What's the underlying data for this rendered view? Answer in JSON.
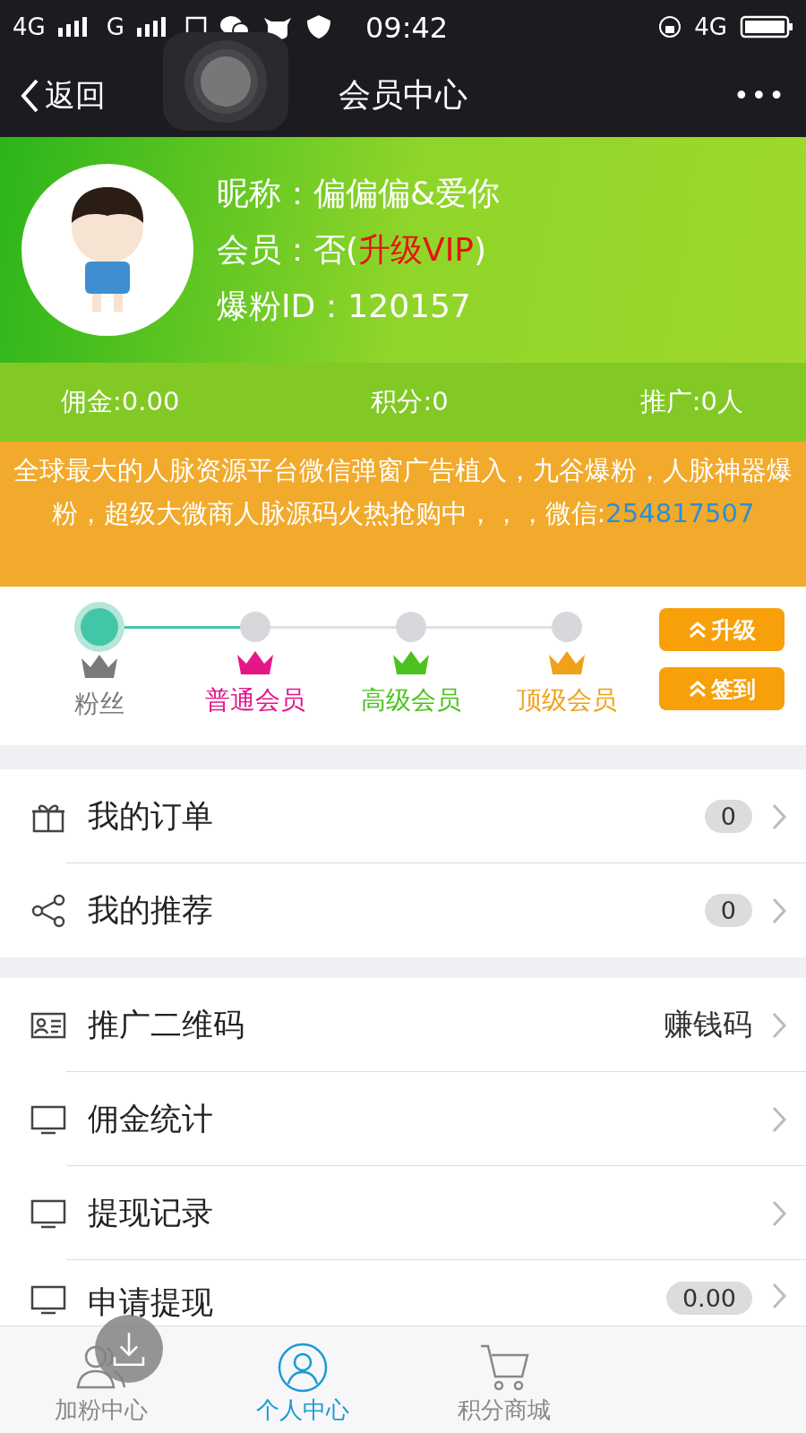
{
  "status_bar": {
    "network_1": "4G",
    "network_2": "G",
    "time": "09:42",
    "network_right": "4G"
  },
  "nav": {
    "back": "返回",
    "title": "会员中心",
    "more": "•••"
  },
  "profile": {
    "fields": [
      {
        "label": "昵称：",
        "value": "偏偏偏&爱你"
      },
      {
        "label": "会员：",
        "value": "否(",
        "link": "升级VIP",
        "suffix": ")"
      },
      {
        "label": "爆粉ID：",
        "value": "120157"
      }
    ]
  },
  "stats": [
    "佣金:0.00",
    "积分:0",
    "推广:0人"
  ],
  "notice": {
    "text": "全球最大的人脉资源平台微信弹窗广告植入，九谷爆粉，人脉神器爆粉，超级大微商人脉源码火热抢购中，，，微信:",
    "contact": "254817507"
  },
  "levels": [
    {
      "label": "粉丝",
      "color": "#7a7a7a",
      "selected": true
    },
    {
      "label": "普通会员",
      "color": "#e5168a",
      "selected": false
    },
    {
      "label": "高级会员",
      "color": "#4cc21e",
      "selected": false
    },
    {
      "label": "顶级会员",
      "color": "#f0a11a",
      "selected": false
    }
  ],
  "level_buttons": [
    "升级",
    "签到"
  ],
  "menu_groups": [
    [
      {
        "kind": "badge",
        "label": "我的订单",
        "badge": "0"
      },
      {
        "kind": "badge",
        "label": "我的推荐",
        "badge": "0"
      }
    ],
    [
      {
        "kind": "value",
        "label": "推广二维码",
        "value": "赚钱码"
      },
      {
        "kind": "plain",
        "label": "佣金统计"
      },
      {
        "kind": "plain",
        "label": "提现记录"
      },
      {
        "kind": "badge",
        "label": "申请提现",
        "badge": "0.00"
      }
    ]
  ],
  "tab_bar": [
    {
      "label": "加粉中心",
      "selected": false
    },
    {
      "label": "个人中心",
      "selected": true
    },
    {
      "label": "积分商城",
      "selected": false
    }
  ]
}
